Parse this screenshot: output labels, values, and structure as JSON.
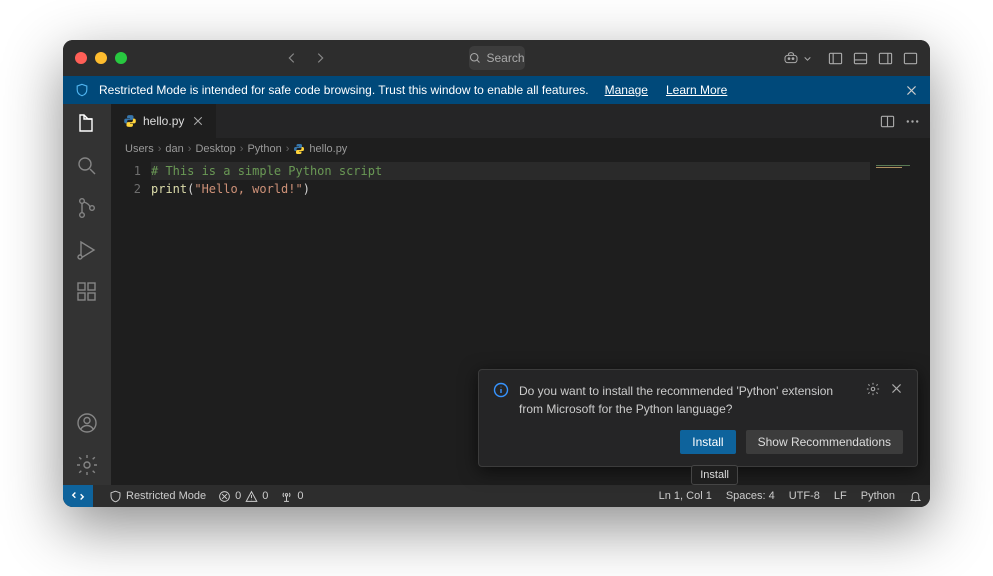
{
  "titlebar": {
    "search_placeholder": "Search"
  },
  "banner": {
    "message": "Restricted Mode is intended for safe code browsing. Trust this window to enable all features.",
    "manage": "Manage",
    "learn_more": "Learn More"
  },
  "tab": {
    "filename": "hello.py"
  },
  "breadcrumbs": {
    "segments": [
      "Users",
      "dan",
      "Desktop",
      "Python"
    ],
    "file": "hello.py"
  },
  "code": {
    "line1_num": "1",
    "line2_num": "2",
    "line1_comment": "# This is a simple Python script",
    "line2_fn": "print",
    "line2_open": "(",
    "line2_str": "\"Hello, world!\"",
    "line2_close": ")"
  },
  "status": {
    "restricted": "Restricted Mode",
    "errors": "0",
    "warnings": "0",
    "ports": "0",
    "ln_col": "Ln 1, Col 1",
    "spaces": "Spaces: 4",
    "encoding": "UTF-8",
    "eol": "LF",
    "language": "Python"
  },
  "toast": {
    "message": "Do you want to install the recommended 'Python' extension from Microsoft for the Python language?",
    "install": "Install",
    "show_recommendations": "Show Recommendations",
    "tooltip": "Install"
  }
}
